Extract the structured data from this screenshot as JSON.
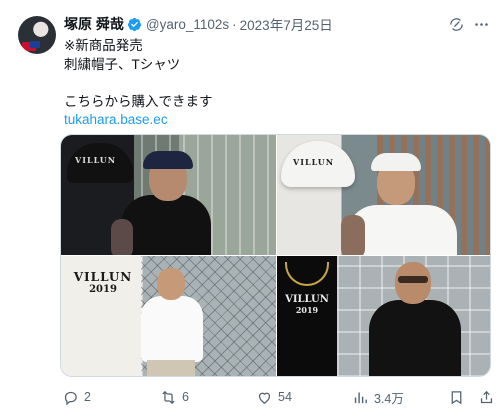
{
  "author": {
    "name": "塚原 舜哉",
    "handle": "@yaro_1102s",
    "separator": "·",
    "date": "2023年7月25日",
    "verified_color": "#1d9bf0"
  },
  "tweet": {
    "line1": "※新商品発売",
    "line2": "刺繍帽子、Tシャツ",
    "line3": "こちらから購入できます",
    "link": "tukahara.base.ec",
    "link_color": "#1d9bf0"
  },
  "media": {
    "photo1_cap_text": "VILLUN",
    "photo2_cap_text": "VILLUN",
    "photo3_logo_line1": "VILLUN",
    "photo3_logo_line2": "2019",
    "photo4_logo_line1": "VILLUN",
    "photo4_logo_line2": "2019"
  },
  "actions": {
    "replies": "2",
    "reposts": "6",
    "likes": "54",
    "views": "3.4万"
  },
  "icons": {
    "header": [
      "grok-icon",
      "more-icon"
    ],
    "actions": [
      "reply-icon",
      "repost-icon",
      "like-icon",
      "views-icon",
      "bookmark-icon",
      "share-icon"
    ]
  }
}
